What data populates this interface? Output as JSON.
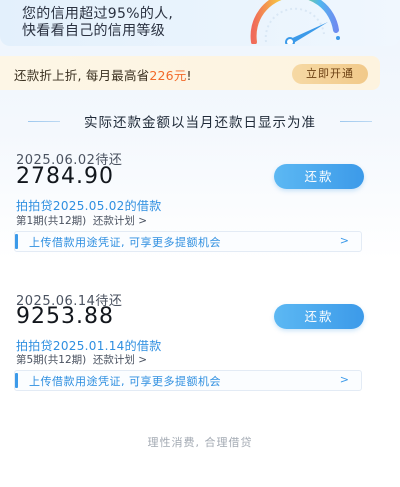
{
  "credit_banner": {
    "line1": "您的信用超过95%的人,",
    "line2": "快看看自己的信用等级"
  },
  "promo": {
    "prefix": "还款折上折, 每月最高省",
    "amount": "226元",
    "suffix": "!",
    "button_label": "立即开通"
  },
  "section_heading": "实际还款金额以当月还款日显示为准",
  "loans": [
    {
      "due_date": "2025.06.02待还",
      "amount": "2784.90",
      "repay_label": "还款",
      "source": "拍拍贷2025.05.02的借款",
      "period": "第1期(共12期)",
      "plan_link": "还款计划 >",
      "upload_text": "上传借款用途凭证, 可享更多提额机会",
      "upload_arrow": ">"
    },
    {
      "due_date": "2025.06.14待还",
      "amount": "9253.88",
      "repay_label": "还款",
      "source": "拍拍贷2025.01.14的借款",
      "period": "第5期(共12期)",
      "plan_link": "还款计划 >",
      "upload_text": "上传借款用途凭证, 可享更多提额机会",
      "upload_arrow": ">"
    }
  ],
  "footer": "理性消费, 合理借贷",
  "colors": {
    "accent_blue": "#3c9ae9",
    "promo_orange": "#f26a2a",
    "promo_button": "#f1c98a"
  }
}
